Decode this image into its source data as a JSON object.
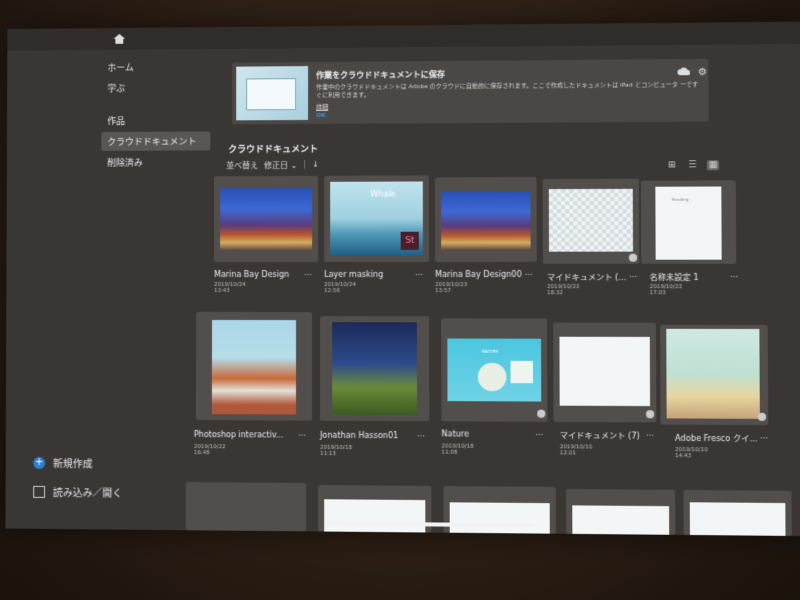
{
  "sidebar": {
    "items": [
      {
        "label": "ホーム"
      },
      {
        "label": "学ぶ"
      },
      {
        "label": "作品"
      },
      {
        "label": "クラウドドキュメント"
      },
      {
        "label": "削除済み"
      }
    ],
    "new_label": "新規作成",
    "import_label": "読み込み／開く"
  },
  "banner": {
    "title": "作業をクラウドドキュメントに保存",
    "text": "作業中のクラウドドキュメントは Adobe のクラウドに自動的に保存されます。ここで作成したドキュメントは iPad とコンピュータ ーですぐに利用できます。",
    "link": "詳細",
    "ok": "OK"
  },
  "main": {
    "section_title": "クラウドドキュメント",
    "sort_label": "並べ替え",
    "sort_value": "修正日",
    "more_glyph": "…"
  },
  "cards": [
    {
      "name": "Marina Bay Design",
      "date": "2019/10/24 13:43"
    },
    {
      "name": "Layer masking",
      "date": "2019/10/24 12:56",
      "overlay": "Whale",
      "badge": "St"
    },
    {
      "name": "Marina Bay Design00",
      "date": "2019/10/23 13:57"
    },
    {
      "name": "マイドキュメント (...",
      "date": "2019/10/22 18:32"
    },
    {
      "name": "名称未設定 1",
      "date": "2019/10/22 17:03",
      "overlay": "Reading"
    },
    {
      "name": "Photoshop interactiv...",
      "date": "2019/10/22 16:48"
    },
    {
      "name": "Jonathan Hasson01",
      "date": "2019/10/18 11:13"
    },
    {
      "name": "Nature",
      "date": "2019/10/18 11:08",
      "overlay": "NATURE"
    },
    {
      "name": "マイドキュメント (7)",
      "date": "2019/10/10 12:01"
    },
    {
      "name": "Adobe Fresco クイ...",
      "date": "2019/10/10 14:43"
    }
  ],
  "colors": {
    "accent": "#2a7fd8",
    "panel": "#3a3634"
  }
}
